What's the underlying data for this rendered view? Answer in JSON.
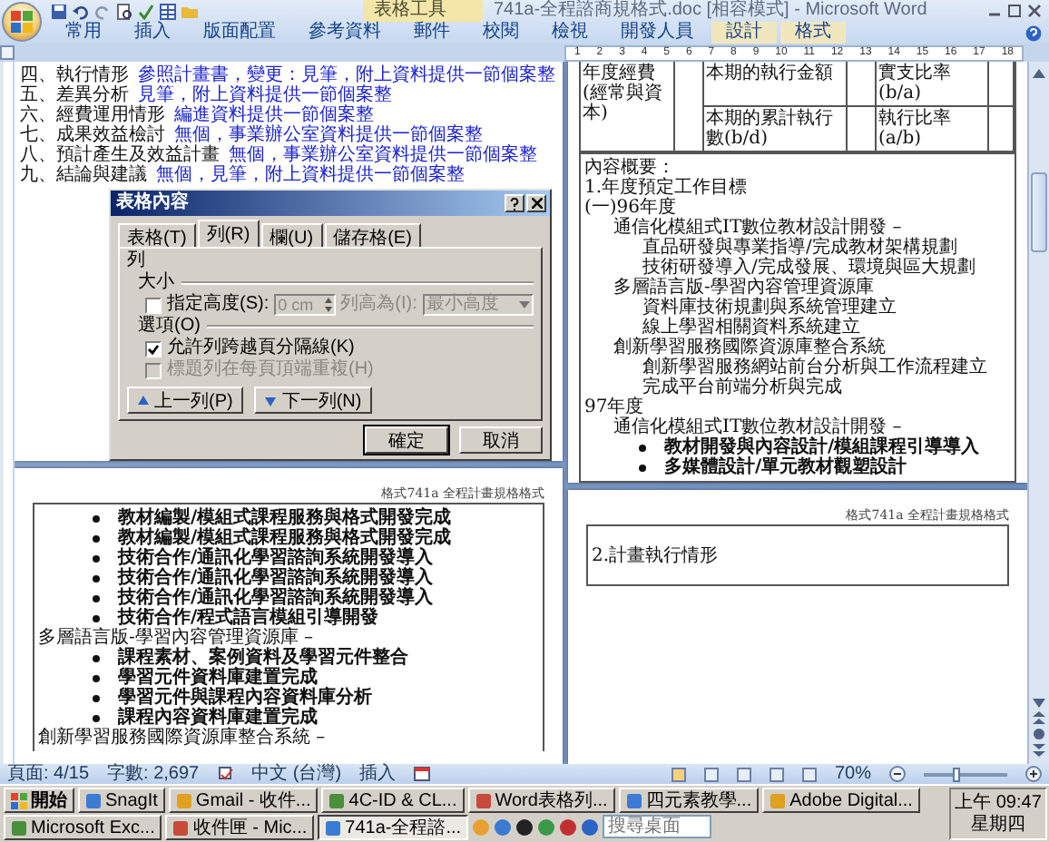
{
  "window": {
    "title": "741a-全程諮商規格式.doc [相容模式] - Microsoft Word",
    "context_title": "表格工具"
  },
  "ribbon_tabs": [
    {
      "label": "常用",
      "kind": "main"
    },
    {
      "label": "插入",
      "kind": "main"
    },
    {
      "label": "版面配置",
      "kind": "main"
    },
    {
      "label": "參考資料",
      "kind": "main"
    },
    {
      "label": "郵件",
      "kind": "main"
    },
    {
      "label": "校閱",
      "kind": "main"
    },
    {
      "label": "檢視",
      "kind": "main"
    },
    {
      "label": "開發人員",
      "kind": "main"
    },
    {
      "label": "設計",
      "kind": "context"
    },
    {
      "label": "格式",
      "kind": "context"
    }
  ],
  "ruler": {
    "numbers": [
      "1",
      "2",
      "3",
      "4",
      "5",
      "6",
      "7",
      "8",
      "9",
      "10",
      "11",
      "12",
      "13",
      "14",
      "15",
      "16",
      "17",
      "18"
    ]
  },
  "page_1": {
    "items": [
      {
        "label": "四、執行情形",
        "text": "參照計畫書，變更：見筆，附上資料提供一節個案整"
      },
      {
        "label": "五、差異分析",
        "text": "見筆，附上資料提供一節個案整"
      },
      {
        "label": "六、經費運用情形",
        "text": "編進資料提供一節個案整"
      },
      {
        "label": "七、成果效益檢討",
        "text": "無個，事業辦公室資料提供一節個案整"
      },
      {
        "label": "八、預計產生及效益計畫",
        "text": "無個，事業辦公室資料提供一節個案整"
      },
      {
        "label": "九、結論與建議",
        "text": "無個，見筆，附上資料提供一節個案整"
      }
    ]
  },
  "page_2": {
    "table": {
      "row_header": "年度經費 (經常與資本)",
      "rows": [
        {
          "label": "本期的執行金額",
          "ratio_label": "實支比率(b/a)"
        },
        {
          "label": "本期的累計執行數(b/d)",
          "ratio_label": "執行比率(a/b)"
        }
      ]
    },
    "lines": [
      {
        "text": "內容概要：",
        "kind": "plain"
      },
      {
        "text": "1.年度預定工作目標",
        "kind": "plain"
      },
      {
        "text": "(一)96年度",
        "kind": "plain"
      },
      {
        "text": "通信化模組式IT數位教材設計開發 –",
        "kind": "indent"
      },
      {
        "text": "直品研發與專業指導/完成教材架構規劃",
        "kind": "indent2"
      },
      {
        "text": "技術研發導入/完成發展、環境與區大規劃",
        "kind": "indent2"
      },
      {
        "text": "多層語言版-學習內容管理資源庫",
        "kind": "indent"
      },
      {
        "text": "資料庫技術規劃與系統管理建立",
        "kind": "indent2"
      },
      {
        "text": "線上學習相關資料系統建立",
        "kind": "indent2"
      },
      {
        "text": "創新學習服務國際資源庫整合系統",
        "kind": "indent"
      },
      {
        "text": "創新學習服務網站前台分析與工作流程建立",
        "kind": "indent2"
      },
      {
        "text": "完成平台前端分析與完成",
        "kind": "indent2"
      },
      {
        "text": "97年度",
        "kind": "plain"
      },
      {
        "text": "通信化模組式IT數位教材設計開發 –",
        "kind": "indent"
      },
      {
        "text": "教材開發與內容設計/模組課程引導導入",
        "kind": "bullet"
      },
      {
        "text": "多媒體設計/單元教材觀塑設計",
        "kind": "bullet"
      }
    ]
  },
  "page_3": {
    "header": "格式741a 全程計畫規格格式",
    "lines": [
      {
        "text": "教材編製/模組式課程服務與格式開發完成",
        "kind": "bullet"
      },
      {
        "text": "教材編製/模組式課程服務與格式開發完成",
        "kind": "bullet"
      },
      {
        "text": "技術合作/通訊化學習諮詢系統開發導入",
        "kind": "bullet"
      },
      {
        "text": "技術合作/通訊化學習諮詢系統開發導入",
        "kind": "bullet"
      },
      {
        "text": "技術合作/通訊化學習諮詢系統開發導入",
        "kind": "bullet"
      },
      {
        "text": "技術合作/程式語言模組引導開發",
        "kind": "bullet"
      },
      {
        "text": "多層語言版-學習內容管理資源庫 –",
        "kind": "plain"
      },
      {
        "text": "課程素材、案例資料及學習元件整合",
        "kind": "bullet"
      },
      {
        "text": "學習元件資料庫建置完成",
        "kind": "bullet"
      },
      {
        "text": "學習元件與課程內容資料庫分析",
        "kind": "bullet"
      },
      {
        "text": "課程內容資料庫建置完成",
        "kind": "bullet"
      },
      {
        "text": "創新學習服務國際資源庫整合系統 –",
        "kind": "plain"
      }
    ]
  },
  "page_4": {
    "header": "格式741a 全程計畫規格格式",
    "lines": [
      {
        "text": "2.計畫執行情形",
        "kind": "plain"
      }
    ]
  },
  "dialog": {
    "title": "表格內容",
    "tabs": [
      {
        "label": "表格(T)",
        "selected": false
      },
      {
        "label": "列(R)",
        "selected": true
      },
      {
        "label": "欄(U)",
        "selected": false
      },
      {
        "label": "儲存格(E)",
        "selected": false
      }
    ],
    "section": "列",
    "size_label": "大小",
    "height_checkbox": {
      "label": "指定高度(S):",
      "checked": false
    },
    "height_value": "0 cm",
    "row_height_label": "列高為(I):",
    "row_height_value": "最小高度",
    "options_label": "選項(O)",
    "options": [
      {
        "label": "允許列跨越頁分隔線(K)",
        "checked": true,
        "disabled": false
      },
      {
        "label": "標題列在每頁頂端重複(H)",
        "checked": false,
        "disabled": true
      }
    ],
    "nav_buttons": [
      "上一列(P)",
      "下一列(N)"
    ],
    "buttons": [
      "確定",
      "取消"
    ]
  },
  "status_bar": {
    "page": "頁面: 4/15",
    "words": "字數: 2,697",
    "language": "中文 (台灣)",
    "mode": "插入",
    "zoom": "70%",
    "zoom_slider": {
      "level": 0.4
    }
  },
  "taskbar": {
    "start": "開始",
    "tasks": [
      {
        "label": "SnagIt",
        "selected": false
      },
      {
        "label": "Gmail - 收件...",
        "selected": false
      },
      {
        "label": "4C-ID & CL...",
        "selected": false
      },
      {
        "label": "Word表格列...",
        "selected": false
      },
      {
        "label": "四元素教學...",
        "selected": false
      },
      {
        "label": "Adobe Digital...",
        "selected": false
      },
      {
        "label": "Microsoft Exc...",
        "selected": false
      },
      {
        "label": "收件匣 - Mic...",
        "selected": false
      },
      {
        "label": "741a-全程諮...",
        "selected": true
      }
    ],
    "search_placeholder": "搜尋桌面",
    "clock": {
      "time": "上午 09:47",
      "day": "星期四"
    }
  }
}
